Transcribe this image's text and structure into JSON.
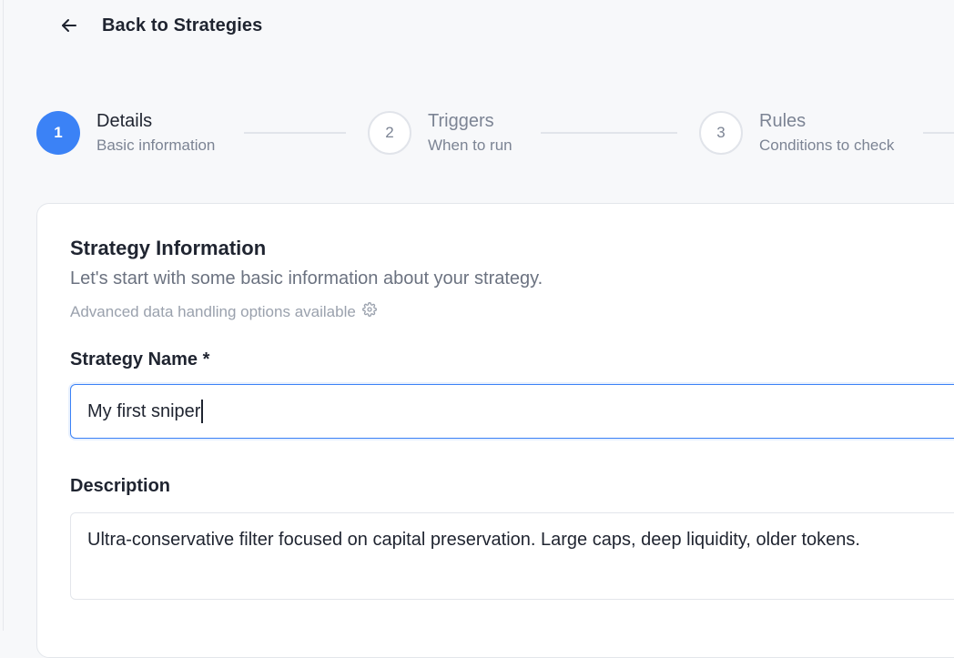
{
  "back_link": {
    "label": "Back to Strategies",
    "icon": "arrow-left-icon"
  },
  "stepper": {
    "steps": [
      {
        "number": "1",
        "title": "Details",
        "subtitle": "Basic information",
        "state": "active"
      },
      {
        "number": "2",
        "title": "Triggers",
        "subtitle": "When to run",
        "state": "inactive"
      },
      {
        "number": "3",
        "title": "Rules",
        "subtitle": "Conditions to check",
        "state": "inactive"
      }
    ]
  },
  "form": {
    "title": "Strategy Information",
    "subtitle": "Let's start with some basic information about your strategy.",
    "advanced_note": "Advanced data handling options available",
    "advanced_icon": "gear-icon",
    "name_label": "Strategy Name *",
    "name_value": "My first sniper",
    "description_label": "Description",
    "description_value": "Ultra-conservative filter focused on capital preservation. Large caps, deep liquidity, older tokens."
  },
  "colors": {
    "accent": "#3b82f6",
    "background": "#f7f8fa",
    "text": "#1f2430",
    "muted": "#7c8494"
  }
}
